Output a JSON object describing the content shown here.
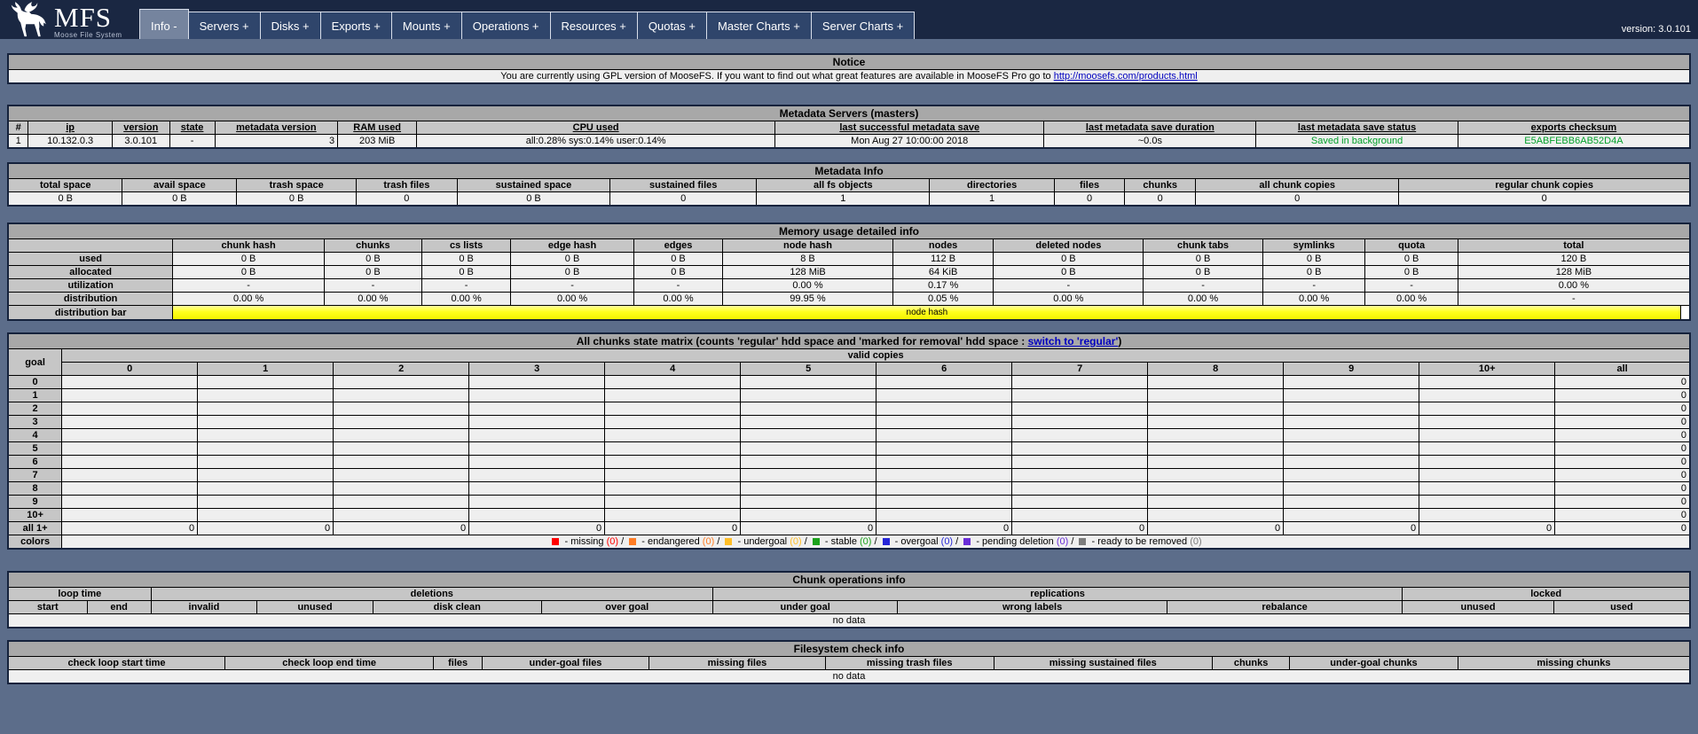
{
  "header": {
    "logo_title": "MFS",
    "logo_subtitle": "Moose File System",
    "version_label": "version: 3.0.101",
    "tabs": [
      {
        "name": "tab-info",
        "label": "Info -",
        "active": true
      },
      {
        "name": "tab-servers",
        "label": "Servers +",
        "active": false
      },
      {
        "name": "tab-disks",
        "label": "Disks +",
        "active": false
      },
      {
        "name": "tab-exports",
        "label": "Exports +",
        "active": false
      },
      {
        "name": "tab-mounts",
        "label": "Mounts +",
        "active": false
      },
      {
        "name": "tab-operations",
        "label": "Operations +",
        "active": false
      },
      {
        "name": "tab-resources",
        "label": "Resources +",
        "active": false
      },
      {
        "name": "tab-quotas",
        "label": "Quotas +",
        "active": false
      },
      {
        "name": "tab-master-charts",
        "label": "Master Charts +",
        "active": false
      },
      {
        "name": "tab-server-charts",
        "label": "Server Charts +",
        "active": false
      }
    ]
  },
  "notice": {
    "title": "Notice",
    "text": "You are currently using GPL version of MooseFS. If you want to find out what great features are available in MooseFS Pro go to ",
    "link": "http://moosefs.com/products.html"
  },
  "masters": {
    "title": "Metadata Servers (masters)",
    "columns": [
      "#",
      "ip",
      "version",
      "state",
      "metadata version",
      "RAM used",
      "CPU used",
      "last successful metadata save",
      "last metadata save duration",
      "last metadata save status",
      "exports checksum"
    ],
    "row": {
      "num": "1",
      "ip": "10.132.0.3",
      "version": "3.0.101",
      "state": "-",
      "metadata_version": "3",
      "ram_used": "203 MiB",
      "cpu_used": "all:0.28% sys:0.14% user:0.14%",
      "last_save": "Mon Aug 27 10:00:00 2018",
      "save_duration": "~0.0s",
      "save_status": "Saved in background",
      "exports_checksum": "E5ABFEBB6AB52D4A"
    }
  },
  "metadata_info": {
    "title": "Metadata Info",
    "columns": [
      "total space",
      "avail space",
      "trash space",
      "trash files",
      "sustained space",
      "sustained files",
      "all fs objects",
      "directories",
      "files",
      "chunks",
      "all chunk copies",
      "regular chunk copies"
    ],
    "values": [
      "0 B",
      "0 B",
      "0 B",
      "0",
      "0 B",
      "0",
      "1",
      "1",
      "0",
      "0",
      "0",
      "0"
    ]
  },
  "memory": {
    "title": "Memory usage detailed info",
    "columns": [
      "chunk hash",
      "chunks",
      "cs lists",
      "edge hash",
      "edges",
      "node hash",
      "nodes",
      "deleted nodes",
      "chunk tabs",
      "symlinks",
      "quota",
      "total"
    ],
    "rows": [
      {
        "label": "used",
        "values": [
          "0 B",
          "0 B",
          "0 B",
          "0 B",
          "0 B",
          "8 B",
          "112 B",
          "0 B",
          "0 B",
          "0 B",
          "0 B",
          "120 B"
        ]
      },
      {
        "label": "allocated",
        "values": [
          "0 B",
          "0 B",
          "0 B",
          "0 B",
          "0 B",
          "128 MiB",
          "64 KiB",
          "0 B",
          "0 B",
          "0 B",
          "0 B",
          "128 MiB"
        ]
      },
      {
        "label": "utilization",
        "values": [
          "-",
          "-",
          "-",
          "-",
          "-",
          "0.00 %",
          "0.17 %",
          "-",
          "-",
          "-",
          "-",
          "0.00 %"
        ]
      },
      {
        "label": "distribution",
        "values": [
          "0.00 %",
          "0.00 %",
          "0.00 %",
          "0.00 %",
          "0.00 %",
          "99.95 %",
          "0.05 %",
          "0.00 %",
          "0.00 %",
          "0.00 %",
          "0.00 %",
          "-"
        ]
      }
    ],
    "bar_row_label": "distribution bar",
    "bar_text": "node hash",
    "bar_main_pct": 99.5,
    "bar_main_color": "#FFFF1E",
    "bar_rest_color": "#FFFFFF"
  },
  "matrix": {
    "title_prefix": "All chunks state matrix (counts 'regular' hdd space and 'marked for removal' hdd space : ",
    "title_link": "switch to 'regular'",
    "title_suffix": ")",
    "goal_label": "goal",
    "copies_label": "valid copies",
    "copy_columns": [
      "0",
      "1",
      "2",
      "3",
      "4",
      "5",
      "6",
      "7",
      "8",
      "9",
      "10+",
      "all"
    ],
    "rows": [
      {
        "goal": "0",
        "cells": [
          "",
          "",
          "",
          "",
          "",
          "",
          "",
          "",
          "",
          "",
          "",
          "0"
        ]
      },
      {
        "goal": "1",
        "cells": [
          "",
          "",
          "",
          "",
          "",
          "",
          "",
          "",
          "",
          "",
          "",
          "0"
        ]
      },
      {
        "goal": "2",
        "cells": [
          "",
          "",
          "",
          "",
          "",
          "",
          "",
          "",
          "",
          "",
          "",
          "0"
        ]
      },
      {
        "goal": "3",
        "cells": [
          "",
          "",
          "",
          "",
          "",
          "",
          "",
          "",
          "",
          "",
          "",
          "0"
        ]
      },
      {
        "goal": "4",
        "cells": [
          "",
          "",
          "",
          "",
          "",
          "",
          "",
          "",
          "",
          "",
          "",
          "0"
        ]
      },
      {
        "goal": "5",
        "cells": [
          "",
          "",
          "",
          "",
          "",
          "",
          "",
          "",
          "",
          "",
          "",
          "0"
        ]
      },
      {
        "goal": "6",
        "cells": [
          "",
          "",
          "",
          "",
          "",
          "",
          "",
          "",
          "",
          "",
          "",
          "0"
        ]
      },
      {
        "goal": "7",
        "cells": [
          "",
          "",
          "",
          "",
          "",
          "",
          "",
          "",
          "",
          "",
          "",
          "0"
        ]
      },
      {
        "goal": "8",
        "cells": [
          "",
          "",
          "",
          "",
          "",
          "",
          "",
          "",
          "",
          "",
          "",
          "0"
        ]
      },
      {
        "goal": "9",
        "cells": [
          "",
          "",
          "",
          "",
          "",
          "",
          "",
          "",
          "",
          "",
          "",
          "0"
        ]
      },
      {
        "goal": "10+",
        "cells": [
          "",
          "",
          "",
          "",
          "",
          "",
          "",
          "",
          "",
          "",
          "",
          "0"
        ]
      },
      {
        "goal": "all 1+",
        "cells": [
          "0",
          "0",
          "0",
          "0",
          "0",
          "0",
          "0",
          "0",
          "0",
          "0",
          "0",
          "0"
        ]
      }
    ],
    "colors_label": "colors",
    "legend": [
      {
        "label": "missing",
        "count": "(0)",
        "color": "#FF0000"
      },
      {
        "label": "endangered",
        "count": "(0)",
        "color": "#FF7D26"
      },
      {
        "label": "undergoal",
        "count": "(0)",
        "color": "#FFBE28"
      },
      {
        "label": "stable",
        "count": "(0)",
        "color": "#1DA31D"
      },
      {
        "label": "overgoal",
        "count": "(0)",
        "color": "#2626D8"
      },
      {
        "label": "pending deletion",
        "count": "(0)",
        "color": "#6A2ED8"
      },
      {
        "label": "ready to be removed",
        "count": "(0)",
        "color": "#7D7D7D"
      }
    ]
  },
  "chunk_ops": {
    "title": "Chunk operations info",
    "groups": [
      {
        "label": "loop time",
        "span": 2
      },
      {
        "label": "deletions",
        "span": 4
      },
      {
        "label": "replications",
        "span": 3
      },
      {
        "label": "locked",
        "span": 2
      }
    ],
    "columns": [
      "start",
      "end",
      "invalid",
      "unused",
      "disk clean",
      "over goal",
      "under goal",
      "wrong labels",
      "rebalance",
      "unused",
      "used"
    ],
    "empty": "no data"
  },
  "fs_check": {
    "title": "Filesystem check info",
    "columns": [
      "check loop start time",
      "check loop end time",
      "files",
      "under-goal files",
      "missing files",
      "missing trash files",
      "missing sustained files",
      "chunks",
      "under-goal chunks",
      "missing chunks"
    ],
    "empty": "no data"
  }
}
